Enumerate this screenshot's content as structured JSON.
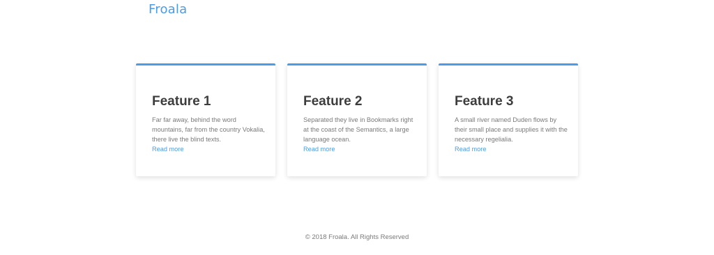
{
  "header": {
    "logo_text": "Froala"
  },
  "features": [
    {
      "title": "Feature 1",
      "text": "Far far away, behind the word mountains, far from the country Vokalia, there live the blind texts.",
      "link_label": "Read more"
    },
    {
      "title": "Feature 2",
      "text": "Separated they live in Bookmarks right at the coast of the Semantics, a large language ocean.",
      "link_label": "Read more"
    },
    {
      "title": "Feature 3",
      "text": "A small river named Duden flows by their small place and supplies it with the necessary regelialia.",
      "link_label": "Read more"
    }
  ],
  "footer": {
    "copyright": "© 2018 Froala. All Rights Reserved"
  },
  "colors": {
    "accent": "#4a9bea",
    "heading": "#3d3d3d",
    "body_text": "#7a7a7a",
    "background": "#ffffff"
  }
}
